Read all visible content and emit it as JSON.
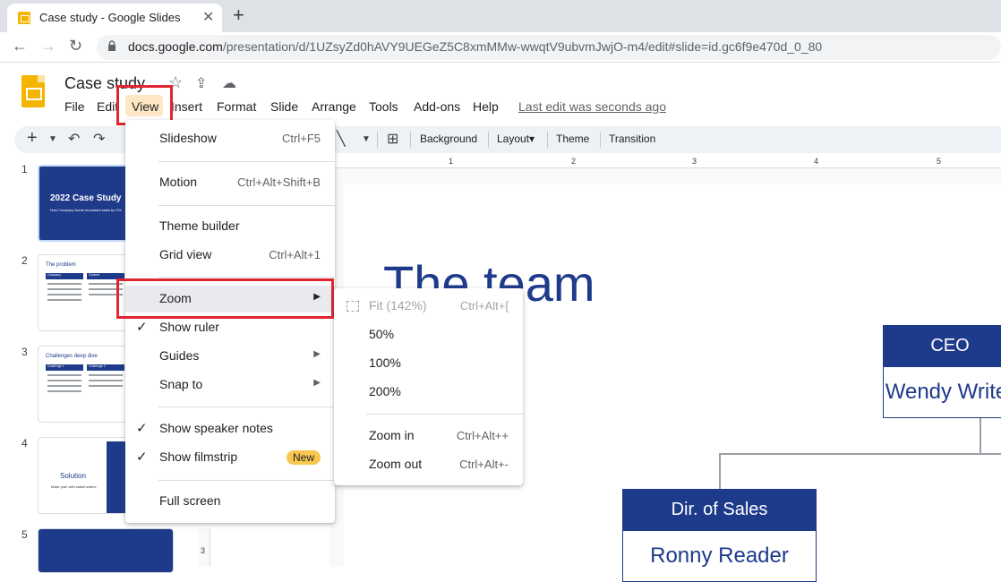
{
  "browser": {
    "tab_title": "Case study - Google Slides",
    "tab_close": "✕",
    "new_tab": "+",
    "back": "←",
    "forward": "→",
    "reload": "↻",
    "url_host": "docs.google.com",
    "url_path": "/presentation/d/1UZsyZd0hAVY9UEGeZ5C8xmMMw-wwqtV9ubvmJwjO-m4/edit#slide=id.gc6f9e470d_0_80"
  },
  "header": {
    "doc_title": "Case study",
    "star": "☆",
    "move": "⇪",
    "cloud": "☁"
  },
  "menubar": {
    "file": "File",
    "edit": "Edit",
    "view": "View",
    "insert": "Insert",
    "format": "Format",
    "slide": "Slide",
    "arrange": "Arrange",
    "tools": "Tools",
    "addons": "Add-ons",
    "help": "Help",
    "last_edit": "Last edit was seconds ago"
  },
  "toolbar": {
    "add": "+",
    "undo": "↶",
    "redo": "↷",
    "line": "╲",
    "comment": "⊞",
    "background": "Background",
    "layout": "Layout▾",
    "theme": "Theme",
    "transition": "Transition"
  },
  "filmstrip": {
    "nums": [
      "1",
      "2",
      "3",
      "4",
      "5"
    ],
    "s1_title": "2022 Case Study",
    "s1_sub": "How Company Name increased sales by X%",
    "s2_title": "The problem",
    "s2_col1": "Company",
    "s2_col2": "Context",
    "s3_title": "Challenges deep dive",
    "s3_col1": "Challenge 1",
    "s3_col2": "Challenge 2",
    "s4_title": "Solution",
    "s4_sub": "Make plan with stakeholders"
  },
  "ruler": {
    "marks": [
      "1",
      "2",
      "3",
      "4",
      "5"
    ],
    "vmark": "3"
  },
  "slide": {
    "title": "The team",
    "ceo_title": "CEO",
    "ceo_name": "Wendy Writer",
    "sales_title": "Dir. of Sales",
    "sales_name": "Ronny Reader"
  },
  "view_menu": {
    "slideshow": "Slideshow",
    "slideshow_sc": "Ctrl+F5",
    "motion": "Motion",
    "motion_sc": "Ctrl+Alt+Shift+B",
    "theme_builder": "Theme builder",
    "grid_view": "Grid view",
    "grid_view_sc": "Ctrl+Alt+1",
    "zoom": "Zoom",
    "show_ruler": "Show ruler",
    "guides": "Guides",
    "snap_to": "Snap to",
    "show_speaker_notes": "Show speaker notes",
    "show_filmstrip": "Show filmstrip",
    "new_badge": "New",
    "full_screen": "Full screen",
    "check": "✓",
    "arrow": "▶"
  },
  "zoom_menu": {
    "fit": "Fit (142%)",
    "fit_sc": "Ctrl+Alt+[",
    "z50": "50%",
    "z100": "100%",
    "z200": "200%",
    "zoom_in": "Zoom in",
    "zoom_in_sc": "Ctrl+Alt++",
    "zoom_out": "Zoom out",
    "zoom_out_sc": "Ctrl+Alt+-"
  },
  "colors": {
    "brand_blue": "#1e3a8a",
    "highlight_red": "#e02530",
    "slides_yellow": "#f4b400"
  }
}
